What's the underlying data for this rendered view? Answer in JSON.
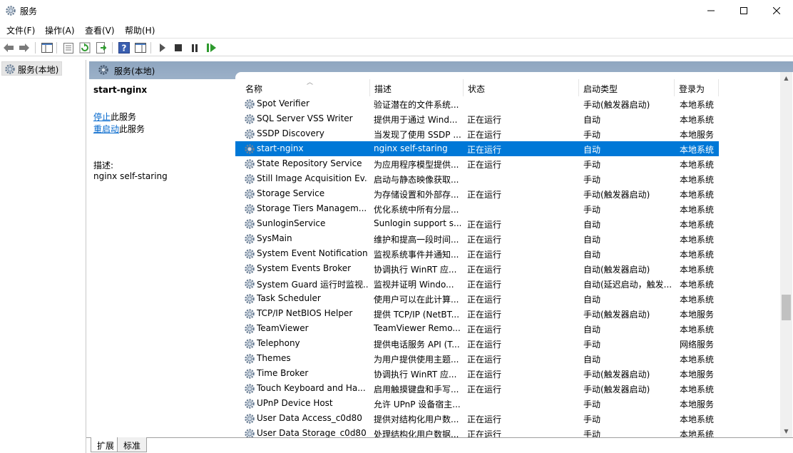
{
  "window": {
    "title": "服务"
  },
  "menu": [
    "文件(F)",
    "操作(A)",
    "查看(V)",
    "帮助(H)"
  ],
  "toolbar_icons": [
    "back-icon",
    "forward-icon",
    "show-hide-tree-icon",
    "properties-icon",
    "refresh-icon",
    "export-list-icon",
    "help-icon",
    "show-hide-action-pane-icon",
    "start-service-icon",
    "stop-service-icon",
    "pause-service-icon",
    "restart-service-icon"
  ],
  "tree": {
    "item": "服务(本地)"
  },
  "panel": {
    "header": "服务(本地)"
  },
  "detail": {
    "service_name": "start-nginx",
    "stop_link": "停止",
    "stop_suffix": "此服务",
    "restart_link": "重启动",
    "restart_suffix": "此服务",
    "desc_label": "描述:",
    "desc_text": "nginx self-staring"
  },
  "columns": [
    "名称",
    "描述",
    "状态",
    "启动类型",
    "登录为"
  ],
  "services": [
    {
      "name": "Spot Verifier",
      "desc": "验证潜在的文件系统...",
      "status": "",
      "startup": "手动(触发器启动)",
      "logon": "本地系统"
    },
    {
      "name": "SQL Server VSS Writer",
      "desc": "提供用于通过 Wind...",
      "status": "正在运行",
      "startup": "自动",
      "logon": "本地系统"
    },
    {
      "name": "SSDP Discovery",
      "desc": "当发现了使用 SSDP ...",
      "status": "正在运行",
      "startup": "手动",
      "logon": "本地服务"
    },
    {
      "name": "start-nginx",
      "desc": "nginx self-staring",
      "status": "正在运行",
      "startup": "自动",
      "logon": "本地系统",
      "selected": true
    },
    {
      "name": "State Repository Service",
      "desc": "为应用程序模型提供...",
      "status": "正在运行",
      "startup": "手动",
      "logon": "本地系统"
    },
    {
      "name": "Still Image Acquisition Ev...",
      "desc": "启动与静态映像获取...",
      "status": "",
      "startup": "手动",
      "logon": "本地系统"
    },
    {
      "name": "Storage Service",
      "desc": "为存储设置和外部存...",
      "status": "正在运行",
      "startup": "手动(触发器启动)",
      "logon": "本地系统"
    },
    {
      "name": "Storage Tiers Managem...",
      "desc": "优化系统中所有分层...",
      "status": "",
      "startup": "手动",
      "logon": "本地系统"
    },
    {
      "name": "SunloginService",
      "desc": "Sunlogin support s...",
      "status": "正在运行",
      "startup": "自动",
      "logon": "本地系统"
    },
    {
      "name": "SysMain",
      "desc": "维护和提高一段时间...",
      "status": "正在运行",
      "startup": "自动",
      "logon": "本地系统"
    },
    {
      "name": "System Event Notification...",
      "desc": "监视系统事件并通知...",
      "status": "正在运行",
      "startup": "自动",
      "logon": "本地系统"
    },
    {
      "name": "System Events Broker",
      "desc": "协调执行 WinRT 应...",
      "status": "正在运行",
      "startup": "自动(触发器启动)",
      "logon": "本地系统"
    },
    {
      "name": "System Guard 运行时监视...",
      "desc": "监视并证明 Windo...",
      "status": "正在运行",
      "startup": "自动(延迟启动，触发...",
      "logon": "本地系统"
    },
    {
      "name": "Task Scheduler",
      "desc": "使用户可以在此计算...",
      "status": "正在运行",
      "startup": "自动",
      "logon": "本地系统"
    },
    {
      "name": "TCP/IP NetBIOS Helper",
      "desc": "提供 TCP/IP (NetBT...",
      "status": "正在运行",
      "startup": "手动(触发器启动)",
      "logon": "本地服务"
    },
    {
      "name": "TeamViewer",
      "desc": "TeamViewer Remo...",
      "status": "正在运行",
      "startup": "自动",
      "logon": "本地系统"
    },
    {
      "name": "Telephony",
      "desc": "提供电话服务 API (T...",
      "status": "正在运行",
      "startup": "手动",
      "logon": "网络服务"
    },
    {
      "name": "Themes",
      "desc": "为用户提供使用主题...",
      "status": "正在运行",
      "startup": "自动",
      "logon": "本地系统"
    },
    {
      "name": "Time Broker",
      "desc": "协调执行 WinRT 应...",
      "status": "正在运行",
      "startup": "手动(触发器启动)",
      "logon": "本地服务"
    },
    {
      "name": "Touch Keyboard and Ha...",
      "desc": "启用触摸键盘和手写...",
      "status": "正在运行",
      "startup": "手动(触发器启动)",
      "logon": "本地系统"
    },
    {
      "name": "UPnP Device Host",
      "desc": "允许 UPnP 设备宿主...",
      "status": "",
      "startup": "手动",
      "logon": "本地服务"
    },
    {
      "name": "User Data Access_c0d80",
      "desc": "提供对结构化用户数...",
      "status": "正在运行",
      "startup": "手动",
      "logon": "本地系统"
    },
    {
      "name": "User Data Storage_c0d80",
      "desc": "处理结构化用户数据...",
      "status": "正在运行",
      "startup": "手动",
      "logon": "本地系统"
    }
  ],
  "tabs": [
    "扩展",
    "标准"
  ]
}
